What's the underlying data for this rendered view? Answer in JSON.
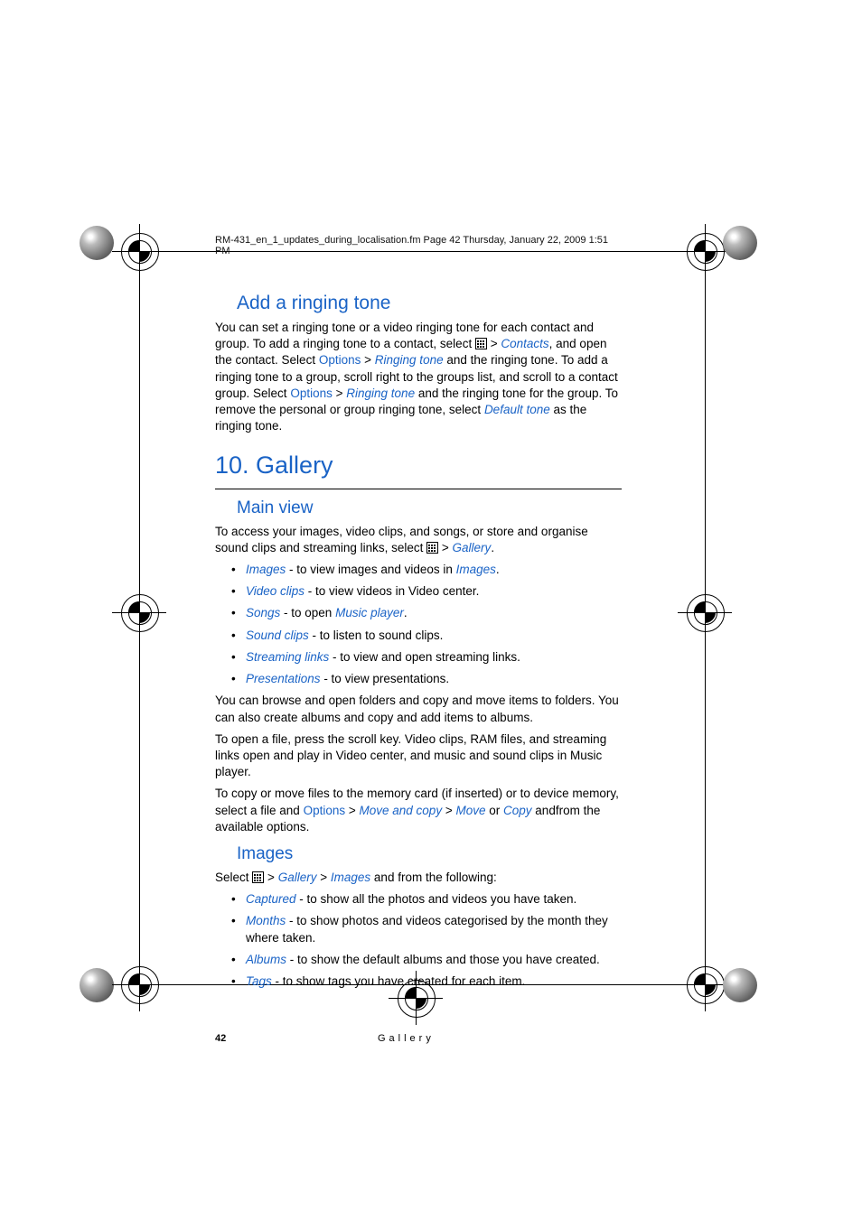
{
  "header": "RM-431_en_1_updates_during_localisation.fm  Page 42  Thursday, January 22, 2009  1:51 PM",
  "ringing": {
    "heading": "Add a ringing tone",
    "p1a": "You can set a ringing tone or a video ringing tone for each contact and group. To add a ringing tone to a contact, select ",
    "contacts": "Contacts",
    "p1b": ", and open the contact. Select ",
    "options1": "Options",
    "ringingtone1": "Ringing tone",
    "p1c": " and the ringing tone. To add a ringing tone to a group, scroll right to the groups list, and scroll to a contact group. Select ",
    "options2": "Options",
    "ringingtone2": "Ringing tone",
    "p1d": " and the ringing tone for the group. To remove the personal or group ringing tone, select ",
    "defaulttone": "Default tone",
    "p1e": " as the ringing tone.",
    "gt": ">"
  },
  "gallery": {
    "chapter": "10. Gallery",
    "main_heading": "Main view",
    "p1a": "To access your images, video clips, and songs, or store and organise sound clips and streaming links, select ",
    "gallery_link": "Gallery",
    "p1b": ".",
    "bullets": [
      {
        "term": "Images",
        "sep": " - to view images and videos in ",
        "link": "Images",
        "tail": "."
      },
      {
        "term": "Video clips",
        "sep": " - to view videos in Video center.",
        "link": "",
        "tail": ""
      },
      {
        "term": "Songs",
        "sep": " - to open ",
        "link": "Music player",
        "tail": "."
      },
      {
        "term": "Sound clips",
        "sep": " - to listen to sound clips.",
        "link": "",
        "tail": ""
      },
      {
        "term": "Streaming links",
        "sep": " - to view and open streaming links.",
        "link": "",
        "tail": ""
      },
      {
        "term": "Presentations",
        "sep": " - to view presentations.",
        "link": "",
        "tail": ""
      }
    ],
    "p2": "You can browse and open folders and copy and move items to folders. You can also create albums and copy and add items to albums.",
    "p3": "To open a file, press the scroll key. Video clips, RAM files, and streaming links open and play in Video center, and music and sound clips in Music player.",
    "p4a": "To copy or move files to the memory card (if inserted) or to device memory, select a file and ",
    "options": "Options",
    "moveandcopy": "Move and copy",
    "move": "Move",
    "or": " or ",
    "copy": "Copy",
    "p4b": " andfrom the available options."
  },
  "images": {
    "heading": "Images",
    "p1a": "Select ",
    "gallery": "Gallery",
    "images": "Images",
    "p1b": " and from the following:",
    "bullets": [
      {
        "term": "Captured",
        "text": " - to show all the photos and videos you have taken."
      },
      {
        "term": "Months",
        "text": " - to show photos and videos categorised by the month they where taken."
      },
      {
        "term": "Albums",
        "text": "  - to show the default albums and those you have created."
      },
      {
        "term": "Tags",
        "text": " - to show tags you have created for each item."
      }
    ]
  },
  "footer": {
    "page": "42",
    "title": "Gallery"
  },
  "gt": ">"
}
